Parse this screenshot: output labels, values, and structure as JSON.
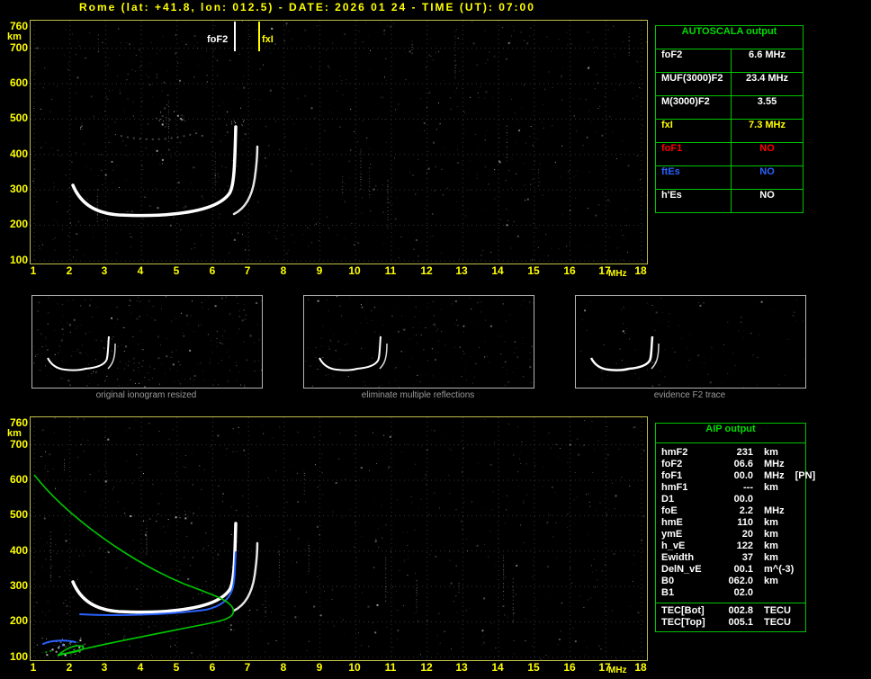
{
  "title": "Rome (lat: +41.8, lon: 012.5) - DATE: 2026 01 24 - TIME (UT): 07:00",
  "axes": {
    "y_ticks": [
      "760",
      "700",
      "600",
      "500",
      "400",
      "300",
      "200",
      "100"
    ],
    "y_unit": "km",
    "x_ticks": [
      "1",
      "2",
      "3",
      "4",
      "5",
      "6",
      "7",
      "8",
      "9",
      "10",
      "11",
      "12",
      "13",
      "14",
      "15",
      "16",
      "17",
      "18"
    ],
    "x_unit": "MHz"
  },
  "ionogram": {
    "annotations": {
      "foF2": "foF2",
      "fxI": "fxI"
    }
  },
  "autoscala_table": {
    "header": "AUTOSCALA output",
    "rows": [
      {
        "label": "foF2",
        "value": "6.6 MHz",
        "color": "#ffffff"
      },
      {
        "label": "MUF(3000)F2",
        "value": "23.4 MHz",
        "color": "#ffffff"
      },
      {
        "label": "M(3000)F2",
        "value": "3.55",
        "color": "#ffffff"
      },
      {
        "label": "fxI",
        "value": "7.3 MHz",
        "color": "#ffff00"
      },
      {
        "label": "foF1",
        "value": "NO",
        "color": "#ff0000"
      },
      {
        "label": "ftEs",
        "value": "NO",
        "color": "#2962ff"
      },
      {
        "label": "h'Es",
        "value": "NO",
        "color": "#ffffff"
      }
    ]
  },
  "thumbnails": [
    {
      "caption": "original ionogram resized"
    },
    {
      "caption": "eliminate multiple reflections"
    },
    {
      "caption": "evidence F2 trace"
    }
  ],
  "aip_table": {
    "header": "AIP output",
    "rows": [
      {
        "label": "hmF2",
        "value": "231",
        "unit": "km",
        "note": ""
      },
      {
        "label": "foF2",
        "value": "06.6",
        "unit": "MHz",
        "note": ""
      },
      {
        "label": "foF1",
        "value": "00.0",
        "unit": "MHz",
        "note": "[PN]"
      },
      {
        "label": "hmF1",
        "value": "---",
        "unit": "km",
        "note": ""
      },
      {
        "label": "D1",
        "value": "00.0",
        "unit": "",
        "note": ""
      },
      {
        "label": "foE",
        "value": "2.2",
        "unit": "MHz",
        "note": ""
      },
      {
        "label": "hmE",
        "value": "110",
        "unit": "km",
        "note": ""
      },
      {
        "label": "ymE",
        "value": "20",
        "unit": "km",
        "note": ""
      },
      {
        "label": "h_vE",
        "value": "122",
        "unit": "km",
        "note": ""
      },
      {
        "label": "Ewidth",
        "value": "37",
        "unit": "km",
        "note": ""
      },
      {
        "label": "DelN_vE",
        "value": "00.1",
        "unit": "m^(-3)",
        "note": ""
      },
      {
        "label": "B0",
        "value": "062.0",
        "unit": "km",
        "note": ""
      },
      {
        "label": "B1",
        "value": "02.0",
        "unit": "",
        "note": ""
      }
    ],
    "tec_rows": [
      {
        "label": "TEC[Bot]",
        "value": "002.8",
        "unit": "TECU",
        "note": ""
      },
      {
        "label": "TEC[Top]",
        "value": "005.1",
        "unit": "TECU",
        "note": ""
      }
    ]
  },
  "colors": {
    "background": "#000000",
    "title_yellow": "#ffff00",
    "plot_border": "#bdbd4a",
    "table_green": "#00c400",
    "trace_white": "#ffffff",
    "fitted_trace_blue": "#2962ff",
    "profile_green": "#00c800",
    "foF1_red": "#ff0000",
    "ftEs_blue": "#2962ff",
    "caption_gray": "#9a9a9a"
  },
  "chart_data": [
    {
      "type": "scatter",
      "title": "ionogram with autoscaled trace (top panel)",
      "xlabel": "MHz",
      "ylabel": "km",
      "xlim": [
        1,
        18
      ],
      "ylim": [
        100,
        760
      ],
      "grid": true,
      "series": [
        {
          "name": "F2 O-mode trace",
          "x": [
            2.1,
            2.4,
            2.8,
            3.2,
            3.8,
            4.5,
            5.2,
            5.8,
            6.2,
            6.4,
            6.5,
            6.6
          ],
          "y": [
            300,
            262,
            243,
            234,
            230,
            230,
            233,
            240,
            255,
            285,
            340,
            430
          ]
        },
        {
          "name": "F2 X-mode trace",
          "x": [
            6.6,
            6.9,
            7.05,
            7.15,
            7.25
          ],
          "y": [
            235,
            255,
            290,
            340,
            410
          ]
        }
      ],
      "annotations": [
        {
          "label": "foF2",
          "x": 6.6
        },
        {
          "label": "fxI",
          "x": 7.3
        }
      ]
    },
    {
      "type": "line",
      "title": "AIP electron density profile with fitted trace (bottom panel)",
      "xlabel": "MHz",
      "ylabel": "km",
      "xlim": [
        1,
        18
      ],
      "ylim": [
        100,
        760
      ],
      "grid": true,
      "series": [
        {
          "name": "electron density profile (green)",
          "x": [
            1.1,
            1.7,
            2.2,
            2.2,
            2.6,
            3.4,
            4.4,
            5.4,
            6.2,
            6.55,
            6.6,
            6.3,
            5.2,
            3.8,
            2.4,
            1.5,
            1.05
          ],
          "y": [
            104,
            108,
            110,
            125,
            152,
            172,
            190,
            207,
            221,
            229,
            231,
            248,
            290,
            360,
            450,
            540,
            610
          ]
        },
        {
          "name": "fitted F2 trace (blue)",
          "x": [
            2.5,
            3.5,
            4.5,
            5.5,
            6.1,
            6.4,
            6.55,
            6.6
          ],
          "y": [
            232,
            230,
            231,
            240,
            258,
            290,
            340,
            400
          ]
        }
      ]
    }
  ]
}
